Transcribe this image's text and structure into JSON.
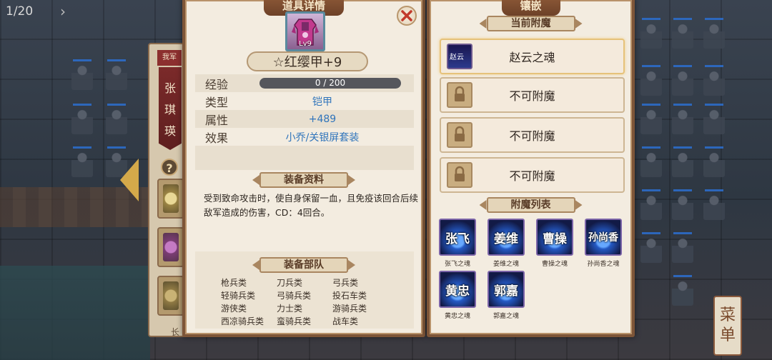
{
  "turn_counter": "1/20",
  "menu_button": [
    "菜",
    "单"
  ],
  "left_strip": {
    "side_tag": "我军",
    "hero_name_chars": [
      "张",
      "琪",
      "瑛"
    ],
    "help_label": "?",
    "bottom_text": "长"
  },
  "equipment_panel": {
    "title": "道具详情",
    "equipment_level": "Lv9",
    "equipment_name": "☆红缨甲+9",
    "stats": [
      {
        "label": "经验",
        "value": "0  / 200"
      },
      {
        "label": "类型",
        "value": "铠甲"
      },
      {
        "label": "属性",
        "value": "+489"
      },
      {
        "label": "效果",
        "value": "小乔/关银屏套装"
      }
    ],
    "experience": {
      "current": 0,
      "max": 200
    },
    "info_section_title": "装备资料",
    "description": "受到致命攻击时，使自身保留一血，且免疫该回合后续敌军造成的伤害，CD：4回合。",
    "troops_section_title": "装备部队",
    "troop_types": [
      "枪兵类",
      "刀兵类",
      "弓兵类",
      "轻骑兵类",
      "弓骑兵类",
      "投石车类",
      "游侠类",
      "力士类",
      "游骑兵类",
      "西凉骑兵类",
      "蛮骑兵类",
      "战车类"
    ]
  },
  "enchant_panel": {
    "title": "镶嵌",
    "current_section_title": "当前附魔",
    "slots": [
      {
        "label": "赵云之魂",
        "icon": "soul-icon",
        "icon_text": "赵云",
        "active": true
      },
      {
        "label": "不可附魔",
        "icon": "lock-icon",
        "active": false
      },
      {
        "label": "不可附魔",
        "icon": "lock-icon",
        "active": false
      },
      {
        "label": "不可附魔",
        "icon": "lock-icon",
        "active": false
      }
    ],
    "list_section_title": "附魔列表",
    "souls": [
      {
        "face": "张飞",
        "caption": "张飞之魂"
      },
      {
        "face": "姜维",
        "caption": "姜维之魂"
      },
      {
        "face": "曹操",
        "caption": "曹操之魂"
      },
      {
        "face": "孙尚香",
        "caption": "孙尚香之魂"
      },
      {
        "face": "黄忠",
        "caption": "黄忠之魂"
      },
      {
        "face": "郭嘉",
        "caption": "郭嘉之魂"
      }
    ]
  },
  "colors": {
    "panel_border": "#7d5538",
    "panel_bg": "#f3ece0",
    "stat_value_blue": "#2f74bb",
    "soul_glow": "#66a8ff"
  }
}
